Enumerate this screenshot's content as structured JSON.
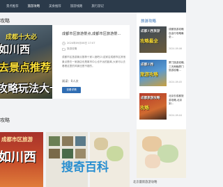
{
  "nav": {
    "items": [
      "景点推荐",
      "旅游攻略",
      "美食推荐",
      "旅游线路",
      "旅行游记"
    ]
  },
  "main": {
    "section_title": "攻略",
    "hero": {
      "line1": "成都十大必",
      "line2": "如川西",
      "line3": "去景点推荐",
      "line4": "攻略玩法大十"
    },
    "article": {
      "title": "成都市区旅游景点,成都市区旅游景...",
      "date": "2024年09月08日 17:07",
      "category": "旅游攻略",
      "summary": "成都市区旅游景点推荐十家1.酒吧(2)这家店成都市区其他景点是在一家酒店也是离市中心也不远的距离,大家可以去看看这里的风景还是不错的。",
      "read_count": "阅读：0人次",
      "button": "查看详情"
    }
  },
  "side": {
    "title": "旅游攻略",
    "items": [
      {
        "thumb_line1": "成都川西旅游",
        "thumb_line2": "攻略最全",
        "text": "成都旅游攻略自由行攻略最全...",
        "date": "2024-09-06"
      },
      {
        "thumb_line1": "成都川西",
        "thumb_line2": "旅游攻略",
        "text": "厦门旅游攻略,三天两晚厦门旅游攻略...",
        "date": "2024-09-05"
      },
      {
        "thumb_line1": "成都旅游攻略",
        "thumb_line2": "攻略",
        "text": "北京去成都旅游攻略,北京到...",
        "date": "2024-09-04"
      }
    ]
  },
  "bottom": {
    "section_title": "攻略",
    "tile1_line1": "成都市区旅游",
    "tile1_line2": "如川西",
    "map_caption": "北京最新旅游攻略"
  },
  "watermark": "搜奇百科",
  "colors": {
    "topbar": "#2b3a4a",
    "accent": "#2f6db3",
    "watermark": "#2a8fd0"
  },
  "icons": [
    "clock-icon",
    "folder-icon"
  ]
}
